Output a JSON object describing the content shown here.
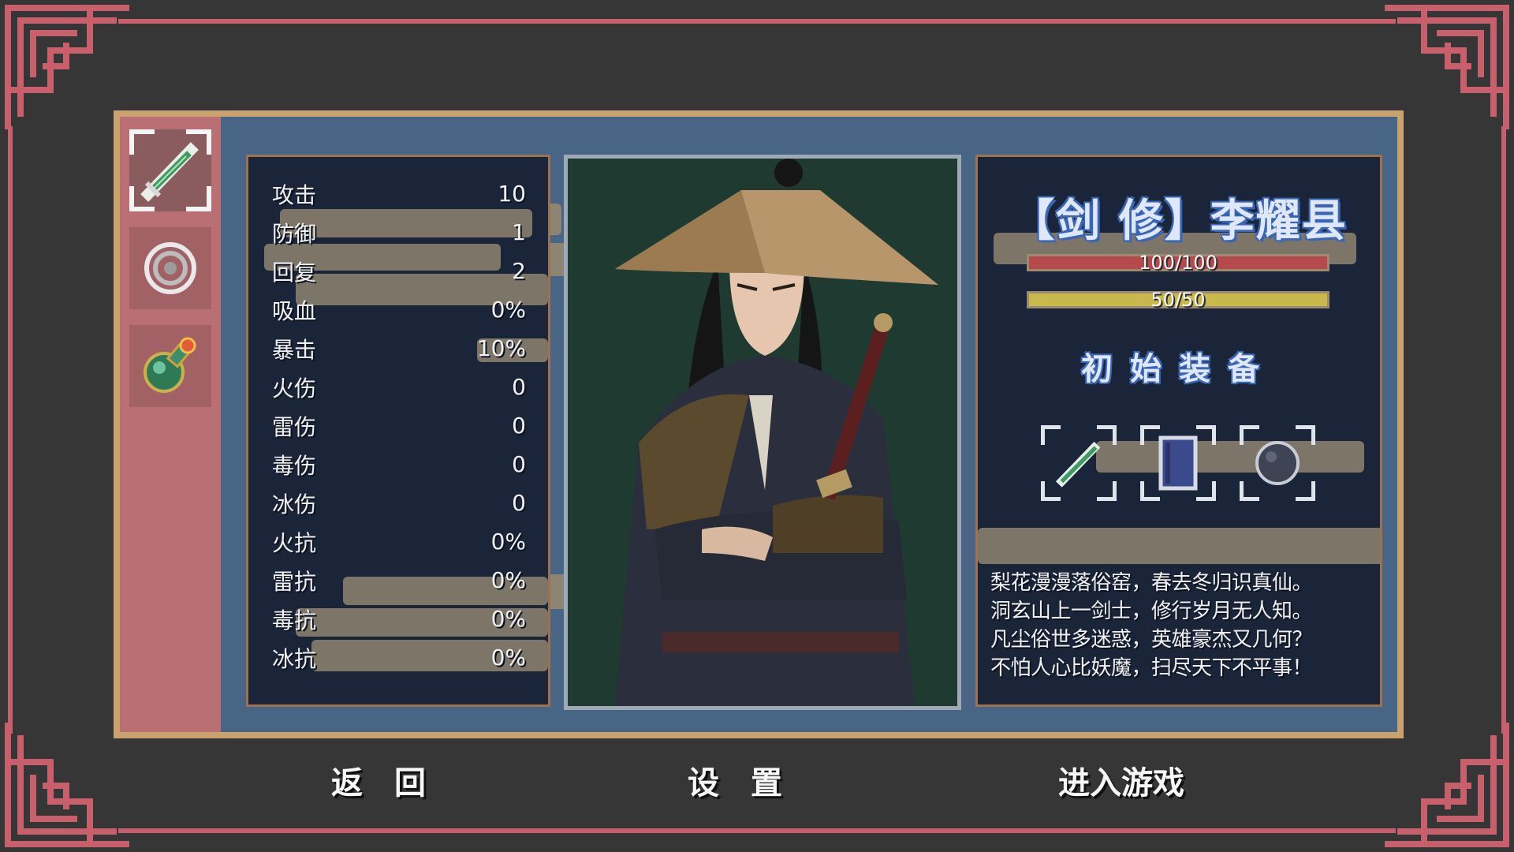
{
  "sidebar": {
    "tabs": [
      {
        "name": "weapon-tab",
        "icon": "sword-icon",
        "active": true
      },
      {
        "name": "armor-tab",
        "icon": "shield-ring-icon",
        "active": false
      },
      {
        "name": "potion-tab",
        "icon": "potion-icon",
        "active": false
      }
    ]
  },
  "stats": [
    {
      "label": "攻击",
      "value": "10"
    },
    {
      "label": "防御",
      "value": "1"
    },
    {
      "label": "回复",
      "value": "2"
    },
    {
      "label": "吸血",
      "value": "0%"
    },
    {
      "label": "暴击",
      "value": "10%"
    },
    {
      "label": "火伤",
      "value": "0"
    },
    {
      "label": "雷伤",
      "value": "0"
    },
    {
      "label": "毒伤",
      "value": "0"
    },
    {
      "label": "冰伤",
      "value": "0"
    },
    {
      "label": "火抗",
      "value": "0%"
    },
    {
      "label": "雷抗",
      "value": "0%"
    },
    {
      "label": "毒抗",
      "value": "0%"
    },
    {
      "label": "冰抗",
      "value": "0%"
    }
  ],
  "character": {
    "name": "【剑 修】李耀县",
    "hp_text": "100/100",
    "hp_fraction": 1.0,
    "mp_text": "50/50",
    "mp_fraction": 1.0,
    "equipment_title": "初始装备",
    "equipment": [
      "sword-icon",
      "book-icon",
      "orb-icon"
    ],
    "poem": [
      "梨花漫漫落俗窑，春去冬归识真仙。",
      "洞玄山上一剑士，修行岁月无人知。",
      "凡尘俗世多迷惑，英雄豪杰又几何？",
      "不怕人心比妖魔，扫尽天下不平事！"
    ]
  },
  "menu": {
    "back": "返　回",
    "settings": "设　置",
    "enter": "进入游戏"
  },
  "colors": {
    "background": "#363636",
    "border_accent": "#c75f6c",
    "panel_frame": "#c9a26d",
    "panel_bg": "#496586",
    "hp_bar": "#b5494b",
    "mp_bar": "#c9b84c"
  }
}
